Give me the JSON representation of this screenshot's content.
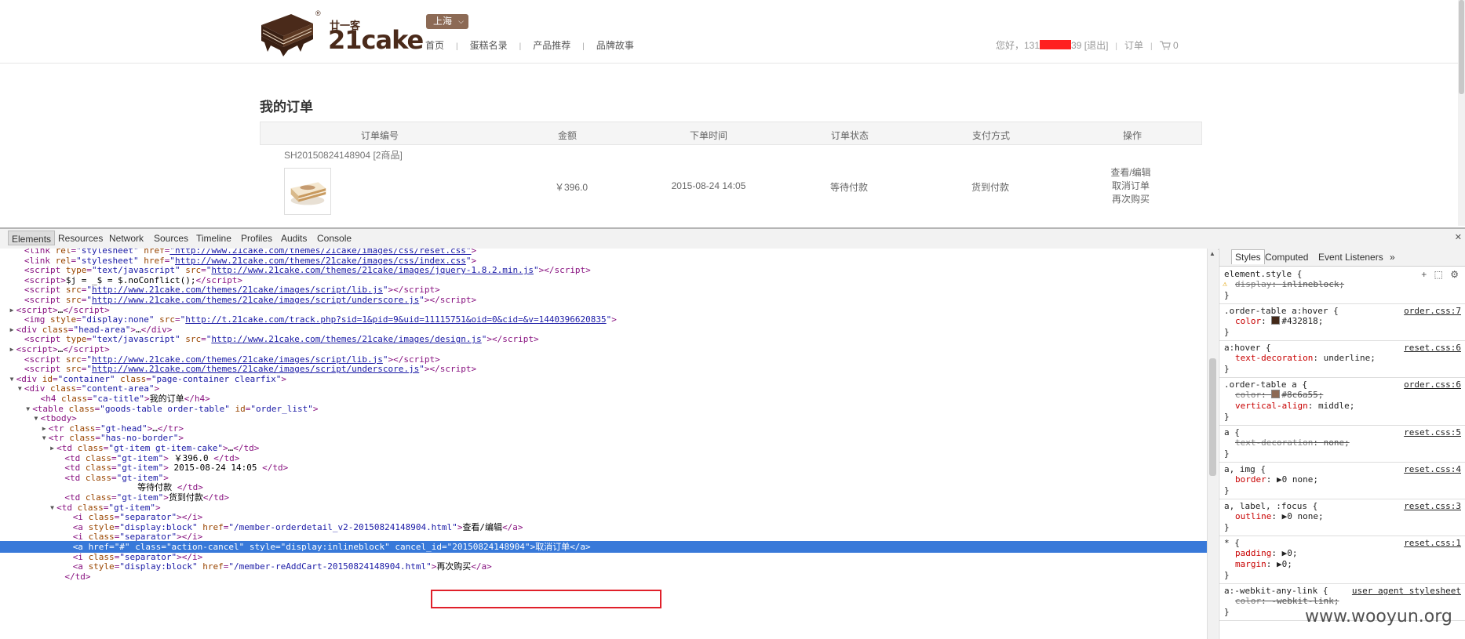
{
  "site": {
    "logo_cn": "廿一客",
    "logo_en": "21cake",
    "logo_reg": "®",
    "city": "上海",
    "nav": [
      "首页",
      "蛋糕名录",
      "产品推荐",
      "品牌故事"
    ],
    "user": {
      "greeting": "您好，131",
      "phone_suffix": "39",
      "logout": "[退出]",
      "orders": "订单",
      "cart_count": "0"
    }
  },
  "orders_page": {
    "title": "我的订单",
    "columns": [
      "订单编号",
      "金额",
      "下单时间",
      "订单状态",
      "支付方式",
      "操作"
    ],
    "order": {
      "id_text": "SH20150824148904 [2商品]",
      "amount": "￥396.0",
      "time": "2015-08-24 14:05",
      "status": "等待付款",
      "payment": "货到付款",
      "actions": [
        "查看/编辑",
        "取消订单",
        "再次购买"
      ]
    }
  },
  "devtools": {
    "tabs": [
      "Elements",
      "Resources",
      "Network",
      "Sources",
      "Timeline",
      "Profiles",
      "Audits",
      "Console"
    ],
    "styles_tabs": [
      "Styles",
      "Computed",
      "Event Listeners",
      "»"
    ],
    "dom_lines": [
      {
        "indent": 3,
        "tri": "",
        "html": "<span class='tg'>&lt;link </span><span class='an'>rel</span>=<span class='av'>\"stylesheet\"</span> <span class='an'>href</span>=<span class='lk'>\"http://www.21cake.com/themes/21cake/images/css/reset.css\"</span><span class='tg'>&gt;</span>"
      },
      {
        "indent": 3,
        "tri": "",
        "html": "<span class='tg'>&lt;link </span><span class='an'>rel</span>=<span class='av'>\"stylesheet\"</span> <span class='an'>href</span>=<span class='av'>\"</span><span class='lk'>http://www.21cake.com/themes/21cake/images/css/index.css</span><span class='av'>\"</span><span class='tg'>&gt;</span>"
      },
      {
        "indent": 3,
        "tri": "",
        "html": "<span class='tg'>&lt;script </span><span class='an'>type</span>=<span class='av'>\"text/javascript\"</span> <span class='an'>src</span>=<span class='av'>\"</span><span class='lk'>http://www.21cake.com/themes/21cake/images/jquery-1.8.2.min.js</span><span class='av'>\"</span><span class='tg'>&gt;&lt;/script&gt;</span>"
      },
      {
        "indent": 3,
        "tri": "",
        "html": "<span class='tg'>&lt;script&gt;</span><span class='tx'>$j = _$ = $.noConflict();</span><span class='tg'>&lt;/script&gt;</span>"
      },
      {
        "indent": 3,
        "tri": "",
        "html": "<span class='tg'>&lt;script </span><span class='an'>src</span>=<span class='av'>\"</span><span class='lk'>http://www.21cake.com/themes/21cake/images/script/lib.js</span><span class='av'>\"</span><span class='tg'>&gt;&lt;/script&gt;</span>"
      },
      {
        "indent": 3,
        "tri": "",
        "html": "<span class='tg'>&lt;script </span><span class='an'>src</span>=<span class='av'>\"</span><span class='lk'>http://www.21cake.com/themes/21cake/images/script/underscore.js</span><span class='av'>\"</span><span class='tg'>&gt;&lt;/script&gt;</span>"
      },
      {
        "indent": 2,
        "tri": "▶",
        "html": "<span class='tg'>&lt;script&gt;</span><span class='tx'>…</span><span class='tg'>&lt;/script&gt;</span>"
      },
      {
        "indent": 3,
        "tri": "",
        "html": "<span class='tg'>&lt;img </span><span class='an'>style</span>=<span class='av'>\"display:none\"</span> <span class='an'>src</span>=<span class='av'>\"</span><span class='lk'>http://t.21cake.com/track.php?sid=1&amp;pid=9&amp;uid=11115751&amp;oid=0&amp;cid=&amp;v=1440396620835</span><span class='av'>\"</span><span class='tg'>&gt;</span>"
      },
      {
        "indent": 2,
        "tri": "▶",
        "html": "<span class='tg'>&lt;div </span><span class='an'>class</span>=<span class='av'>\"head-area\"</span><span class='tg'>&gt;</span><span class='tx'>…</span><span class='tg'>&lt;/div&gt;</span>"
      },
      {
        "indent": 3,
        "tri": "",
        "html": "<span class='tg'>&lt;script </span><span class='an'>type</span>=<span class='av'>\"text/javascript\"</span> <span class='an'>src</span>=<span class='av'>\"</span><span class='lk'>http://www.21cake.com/themes/21cake/images/design.js</span><span class='av'>\"</span><span class='tg'>&gt;&lt;/script&gt;</span>"
      },
      {
        "indent": 2,
        "tri": "▶",
        "html": "<span class='tg'>&lt;script&gt;</span><span class='tx'>…</span><span class='tg'>&lt;/script&gt;</span>"
      },
      {
        "indent": 3,
        "tri": "",
        "html": "<span class='tg'>&lt;script </span><span class='an'>src</span>=<span class='av'>\"</span><span class='lk'>http://www.21cake.com/themes/21cake/images/script/lib.js</span><span class='av'>\"</span><span class='tg'>&gt;&lt;/script&gt;</span>"
      },
      {
        "indent": 3,
        "tri": "",
        "html": "<span class='tg'>&lt;script </span><span class='an'>src</span>=<span class='av'>\"</span><span class='lk'>http://www.21cake.com/themes/21cake/images/script/underscore.js</span><span class='av'>\"</span><span class='tg'>&gt;&lt;/script&gt;</span>"
      },
      {
        "indent": 2,
        "tri": "▼",
        "html": "<span class='tg'>&lt;div </span><span class='an'>id</span>=<span class='av'>\"container\"</span> <span class='an'>class</span>=<span class='av'>\"page-container clearfix\"</span><span class='tg'>&gt;</span>"
      },
      {
        "indent": 3,
        "tri": "▼",
        "html": "<span class='tg'>&lt;div </span><span class='an'>class</span>=<span class='av'>\"content-area\"</span><span class='tg'>&gt;</span>"
      },
      {
        "indent": 5,
        "tri": "",
        "html": "<span class='tg'>&lt;h4 </span><span class='an'>class</span>=<span class='av'>\"ca-title\"</span><span class='tg'>&gt;</span><span class='tx'>我的订单</span><span class='tg'>&lt;/h4&gt;</span>"
      },
      {
        "indent": 4,
        "tri": "▼",
        "html": "<span class='tg'>&lt;table </span><span class='an'>class</span>=<span class='av'>\"goods-table order-table\"</span> <span class='an'>id</span>=<span class='av'>\"order_list\"</span><span class='tg'>&gt;</span>"
      },
      {
        "indent": 5,
        "tri": "▼",
        "html": "<span class='tg'>&lt;tbody&gt;</span>"
      },
      {
        "indent": 6,
        "tri": "▶",
        "html": "<span class='tg'>&lt;tr </span><span class='an'>class</span>=<span class='av'>\"gt-head\"</span><span class='tg'>&gt;</span><span class='tx'>…</span><span class='tg'>&lt;/tr&gt;</span>"
      },
      {
        "indent": 6,
        "tri": "▼",
        "html": "<span class='tg'>&lt;tr </span><span class='an'>class</span>=<span class='av'>\"has-no-border\"</span><span class='tg'>&gt;</span>"
      },
      {
        "indent": 7,
        "tri": "▶",
        "html": "<span class='tg'>&lt;td </span><span class='an'>class</span>=<span class='av'>\"gt-item gt-item-cake\"</span><span class='tg'>&gt;</span><span class='tx'>…</span><span class='tg'>&lt;/td&gt;</span>"
      },
      {
        "indent": 8,
        "tri": "",
        "html": "<span class='tg'>&lt;td </span><span class='an'>class</span>=<span class='av'>\"gt-item\"</span><span class='tg'>&gt;</span><span class='tx'> ￥396.0 </span><span class='tg'>&lt;/td&gt;</span>"
      },
      {
        "indent": 8,
        "tri": "",
        "html": "<span class='tg'>&lt;td </span><span class='an'>class</span>=<span class='av'>\"gt-item\"</span><span class='tg'>&gt;</span><span class='tx'> 2015-08-24 14:05 </span><span class='tg'>&lt;/td&gt;</span>"
      },
      {
        "indent": 8,
        "tri": "",
        "html": "<span class='tg'>&lt;td </span><span class='an'>class</span>=<span class='av'>\"gt-item\"</span><span class='tg'>&gt;</span>"
      },
      {
        "indent": 17,
        "tri": "",
        "html": "<span class='tx'>等待付款 </span><span class='tg'>&lt;/td&gt;</span>"
      },
      {
        "indent": 8,
        "tri": "",
        "html": "<span class='tg'>&lt;td </span><span class='an'>class</span>=<span class='av'>\"gt-item\"</span><span class='tg'>&gt;</span><span class='tx'>货到付款</span><span class='tg'>&lt;/td&gt;</span>"
      },
      {
        "indent": 7,
        "tri": "▼",
        "html": "<span class='tg'>&lt;td </span><span class='an'>class</span>=<span class='av'>\"gt-item\"</span><span class='tg'>&gt;</span>"
      },
      {
        "indent": 9,
        "tri": "",
        "html": "<span class='tg'>&lt;i </span><span class='an'>class</span>=<span class='av'>\"separator\"</span><span class='tg'>&gt;&lt;/i&gt;</span>"
      },
      {
        "indent": 9,
        "tri": "",
        "html": "<span class='tg'>&lt;a </span><span class='an'>style</span>=<span class='av'>\"display:block\"</span> <span class='an'>href</span>=<span class='av'>\"/member-orderdetail_v2-20150824148904.html\"</span><span class='tg'>&gt;</span><span class='tx'>查看/编辑</span><span class='tg'>&lt;/a&gt;</span>"
      },
      {
        "indent": 9,
        "tri": "",
        "html": "<span class='tg'>&lt;i </span><span class='an'>class</span>=<span class='av'>\"separator\"</span><span class='tg'>&gt;&lt;/i&gt;</span>"
      },
      {
        "indent": 9,
        "tri": "",
        "sel": true,
        "html": "<span class='tg'>&lt;a </span><span class='an'>href</span>=<span class='av'>\"#\"</span> <span class='an'>class</span>=<span class='av'>\"action-cancel\"</span> <span class='an'>style</span>=<span class='av'>\"display:inlineblock\"</span> <span class='an'>cancel_id</span>=<span class='av'>\"20150824148904\"</span><span class='tg'>&gt;</span><span class='tx'>取消订单</span><span class='tg'>&lt;/a&gt;</span>"
      },
      {
        "indent": 9,
        "tri": "",
        "html": "<span class='tg'>&lt;i </span><span class='an'>class</span>=<span class='av'>\"separator\"</span><span class='tg'>&gt;&lt;/i&gt;</span>"
      },
      {
        "indent": 9,
        "tri": "",
        "html": "<span class='tg'>&lt;a </span><span class='an'>style</span>=<span class='av'>\"display:block\"</span> <span class='an'>href</span>=<span class='av'>\"/member-reAddCart-20150824148904.html\"</span><span class='tg'>&gt;</span><span class='tx'>再次购买</span><span class='tg'>&lt;/a&gt;</span>"
      },
      {
        "indent": 8,
        "tri": "",
        "html": "<span class='tg'>&lt;/td&gt;</span>"
      }
    ],
    "style_rules": [
      {
        "selector": "element.style {",
        "src": "",
        "warn": true,
        "props": [
          {
            "name": "display",
            "value": "inlineblock;",
            "strike": true
          }
        ]
      },
      {
        "selector": ".order-table a:hover {",
        "src": "order.css:7",
        "props": [
          {
            "name": "color",
            "value": "#432818;",
            "swatch": "#432818"
          }
        ]
      },
      {
        "selector": "a:hover {",
        "src": "reset.css:6",
        "props": [
          {
            "name": "text-decoration",
            "value": "underline;"
          }
        ]
      },
      {
        "selector": ".order-table a {",
        "src": "order.css:6",
        "props": [
          {
            "name": "color",
            "value": "#8c6a55;",
            "swatch": "#8c6a55",
            "strike": true
          },
          {
            "name": "vertical-align",
            "value": "middle;"
          }
        ]
      },
      {
        "selector": "a {",
        "src": "reset.css:5",
        "props": [
          {
            "name": "text-decoration",
            "value": "none;",
            "strike": true
          }
        ]
      },
      {
        "selector": "a, img {",
        "src": "reset.css:4",
        "props": [
          {
            "name": "border",
            "value": "▶0 none;"
          }
        ]
      },
      {
        "selector": "a, label, :focus {",
        "src": "reset.css:3",
        "props": [
          {
            "name": "outline",
            "value": "▶0 none;"
          }
        ]
      },
      {
        "selector": "* {",
        "src": "reset.css:1",
        "props": [
          {
            "name": "padding",
            "value": "▶0;"
          },
          {
            "name": "margin",
            "value": "▶0;"
          }
        ]
      },
      {
        "selector": "a:-webkit-any-link {",
        "src": "user agent stylesheet",
        "props": [
          {
            "name": "color",
            "value": "-webkit-link;",
            "strike": true
          }
        ]
      }
    ]
  },
  "watermark": "www.wooyun.org",
  "colors": {
    "brand": "#8c6a55",
    "dark_brown": "#432818",
    "selection": "#3879d9",
    "highlight_box": "#e0202a"
  }
}
